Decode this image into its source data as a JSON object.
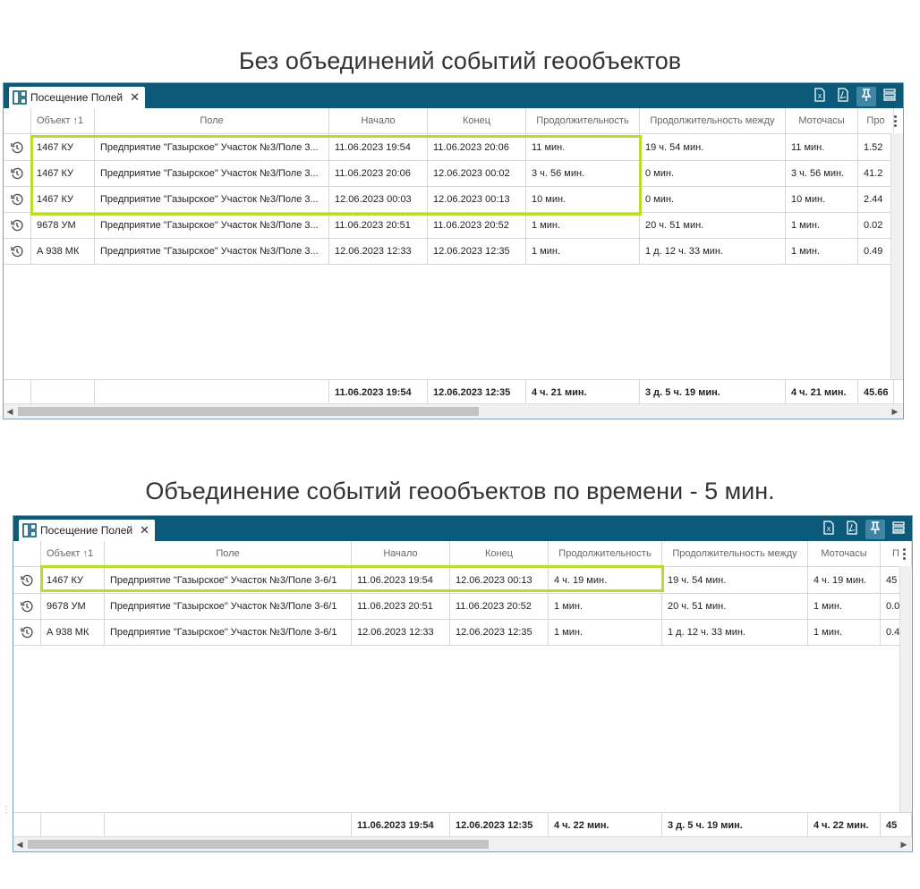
{
  "caption_top": "Без объединений событий геообъектов",
  "caption_bottom": "Объединение событий геообъектов по времени - 5 мин.",
  "tab_label": "Посещение Полей",
  "tab_close": "✕",
  "icons": {
    "tab": "dashboard-icon",
    "excel": "excel-export-icon",
    "pdf": "pdf-export-icon",
    "pin": "pin-icon",
    "layout": "list-layout-icon",
    "row": "history-icon"
  },
  "colors": {
    "titlebar": "#0c5a79",
    "highlight": "#b5de2a",
    "active_tool": "#3f86a6"
  },
  "top": {
    "headers": [
      "Объект ↑1",
      "Поле",
      "Начало",
      "Конец",
      "Продолжительность",
      "Продолжительность между",
      "Моточасы",
      "Про"
    ],
    "rows": [
      [
        "1467 КУ",
        "Предприятие \"Газырское\" Участок №3/Поле 3...",
        "11.06.2023 19:54",
        "11.06.2023 20:06",
        "11 мин.",
        "19 ч. 54 мин.",
        "11 мин.",
        "1.52"
      ],
      [
        "1467 КУ",
        "Предприятие \"Газырское\" Участок №3/Поле 3...",
        "11.06.2023 20:06",
        "12.06.2023 00:02",
        "3 ч. 56 мин.",
        "0 мин.",
        "3 ч. 56 мин.",
        "41.2"
      ],
      [
        "1467 КУ",
        "Предприятие \"Газырское\" Участок №3/Поле 3...",
        "12.06.2023 00:03",
        "12.06.2023 00:13",
        "10 мин.",
        "0 мин.",
        "10 мин.",
        "2.44"
      ],
      [
        "9678 УМ",
        "Предприятие \"Газырское\" Участок №3/Поле 3...",
        "11.06.2023 20:51",
        "11.06.2023 20:52",
        "1 мин.",
        "20 ч. 51 мин.",
        "1 мин.",
        "0.02"
      ],
      [
        "А 938 МК",
        "Предприятие \"Газырское\" Участок №3/Поле 3...",
        "12.06.2023 12:33",
        "12.06.2023 12:35",
        "1 мин.",
        "1 д. 12 ч. 33 мин.",
        "1 мин.",
        "0.49"
      ]
    ],
    "footer": [
      "",
      "",
      "11.06.2023 19:54",
      "12.06.2023 12:35",
      "4 ч. 21 мин.",
      "3 д. 5 ч. 19 мин.",
      "4 ч. 21 мин.",
      "45.66"
    ]
  },
  "bottom": {
    "headers": [
      "Объект ↑1",
      "Поле",
      "Начало",
      "Конец",
      "Продолжительность",
      "Продолжительность между",
      "Моточасы",
      "П"
    ],
    "rows": [
      [
        "1467 КУ",
        "Предприятие \"Газырское\" Участок №3/Поле 3-6/1",
        "11.06.2023 19:54",
        "12.06.2023 00:13",
        "4 ч. 19 мин.",
        "19 ч. 54 мин.",
        "4 ч. 19 мин.",
        "45"
      ],
      [
        "9678 УМ",
        "Предприятие \"Газырское\" Участок №3/Поле 3-6/1",
        "11.06.2023 20:51",
        "11.06.2023 20:52",
        "1 мин.",
        "20 ч. 51 мин.",
        "1 мин.",
        "0.0"
      ],
      [
        "А 938 МК",
        "Предприятие \"Газырское\" Участок №3/Поле 3-6/1",
        "12.06.2023 12:33",
        "12.06.2023 12:35",
        "1 мин.",
        "1 д. 12 ч. 33 мин.",
        "1 мин.",
        "0.4"
      ]
    ],
    "footer": [
      "",
      "",
      "11.06.2023 19:54",
      "12.06.2023 12:35",
      "4 ч. 22 мин.",
      "3 д. 5 ч. 19 мин.",
      "4 ч. 22 мин.",
      "45"
    ]
  }
}
